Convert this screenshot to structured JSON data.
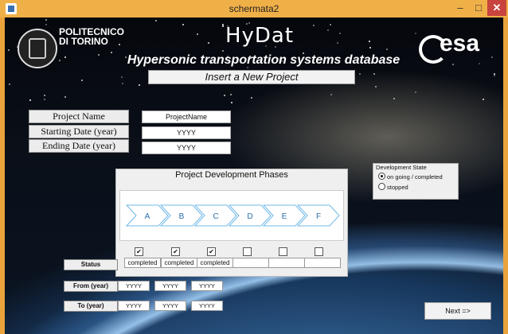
{
  "window": {
    "title": "schermata2",
    "minimize_glyph": "–",
    "maximize_glyph": "□",
    "close_glyph": "✕"
  },
  "branding": {
    "university_line1": "POLITECNICO",
    "university_line2": "DI TORINO",
    "app_title": "HyDat",
    "app_subtitle": "Hypersonic transportation systems database",
    "esa_text": "esa"
  },
  "header": {
    "text": "Insert a New Project"
  },
  "project_form": {
    "name_label": "Project Name",
    "name_value": "ProjectName",
    "start_label": "Starting Date (year)",
    "start_value": "YYYY",
    "end_label": "Ending Date (year)",
    "end_value": "YYYY"
  },
  "phases": {
    "title": "Project Development Phases",
    "items": [
      {
        "label": "A",
        "checked": true,
        "status": "completed",
        "from": "YYYY",
        "to": "YYYY"
      },
      {
        "label": "B",
        "checked": true,
        "status": "completed",
        "from": "YYYY",
        "to": "YYYY"
      },
      {
        "label": "C",
        "checked": true,
        "status": "completed",
        "from": "YYYY",
        "to": "YYYY"
      },
      {
        "label": "D",
        "checked": false,
        "status": ""
      },
      {
        "label": "E",
        "checked": false,
        "status": ""
      },
      {
        "label": "F",
        "checked": false,
        "status": ""
      }
    ],
    "arrow_color": "#6fb8e8",
    "check_glyph": "✔"
  },
  "row_labels": {
    "status": "Status",
    "from": "From (year)",
    "to": "To (year)"
  },
  "development_state": {
    "legend": "Development State",
    "options": [
      {
        "label": "on going / completed",
        "selected": true
      },
      {
        "label": "stopped",
        "selected": false
      }
    ]
  },
  "next_button": {
    "label": "Next =>"
  }
}
